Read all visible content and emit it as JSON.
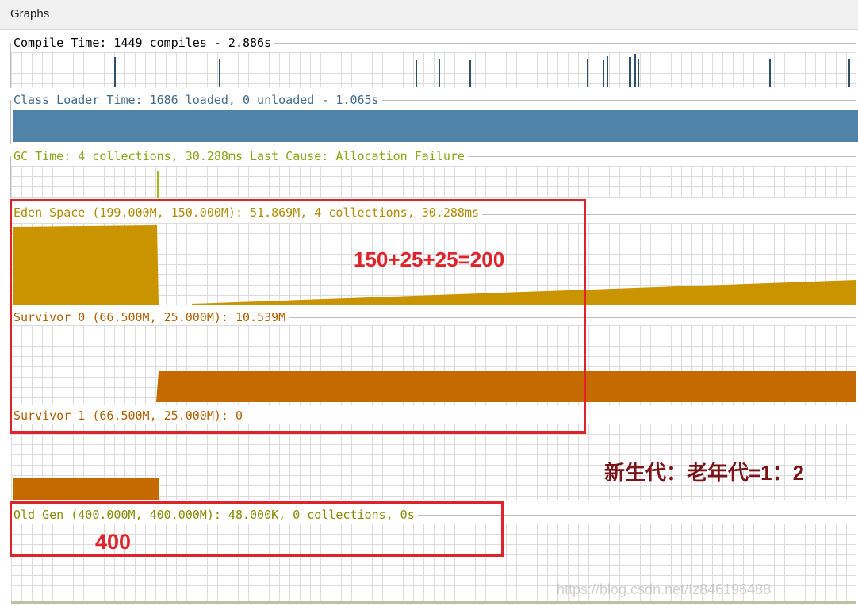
{
  "window": {
    "tab_title": "Graphs"
  },
  "panels": {
    "compile": {
      "title": "Compile Time: 1449 compiles - 2.886s",
      "color": "#2f4f6a"
    },
    "class_loader": {
      "title": "Class Loader Time: 1686 loaded, 0 unloaded - 1.065s",
      "color": "#4f84a8"
    },
    "gc": {
      "title": "GC Time: 4 collections, 30.288ms Last Cause: Allocation Failure",
      "color": "#a4b818"
    },
    "eden": {
      "title": "Eden Space (199.000M, 150.000M): 51.869M, 4 collections, 30.288ms",
      "color": "#c99400"
    },
    "survivor0": {
      "title": "Survivor 0 (66.500M, 25.000M): 10.539M",
      "color": "#c46a00"
    },
    "survivor1": {
      "title": "Survivor 1 (66.500M, 25.000M): 0",
      "color": "#c46a00"
    },
    "old_gen": {
      "title": "Old Gen (400.000M, 400.000M): 48.000K, 0 collections, 0s",
      "color": "#c46a00"
    }
  },
  "annotations": {
    "young_sum": "150+25+25=200",
    "ratio": "新生代：老年代=1：2",
    "old_size": "400",
    "highlight_color": "#e0222a"
  },
  "watermark": "https://blog.csdn.net/Iz846196488"
}
